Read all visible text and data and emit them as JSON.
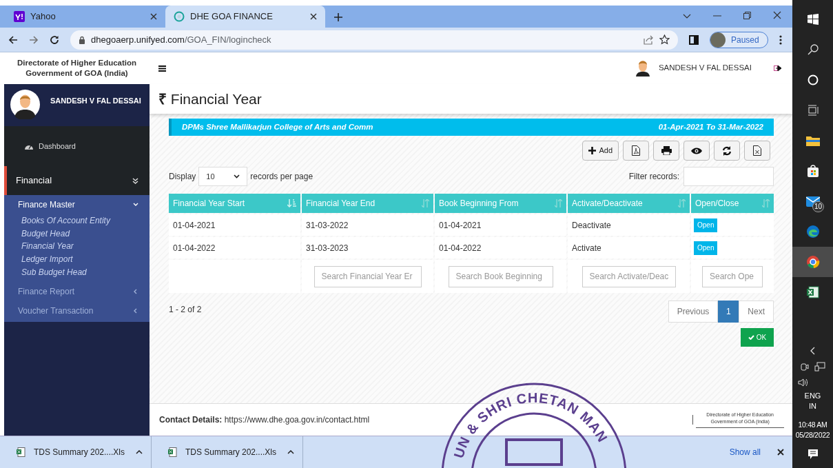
{
  "browser": {
    "tabs": [
      {
        "title": "Yahoo",
        "selected": false
      },
      {
        "title": "DHE GOA FINANCE",
        "selected": true
      }
    ],
    "url_host": "dhegoaerp.unifyed.com",
    "url_path": "/GOA_FIN/logincheck",
    "profile_status": "Paused"
  },
  "header": {
    "org_lines": [
      "Directorate of Higher Education",
      "Government of GOA (India)"
    ],
    "user_name": "SANDESH V FAL DESSAI"
  },
  "sidebar": {
    "user_name": "SANDESH V FAL DESSAI",
    "items": [
      {
        "label": "Dashboard",
        "kind": "link"
      },
      {
        "label": "Financial",
        "kind": "section",
        "expanded": true
      }
    ],
    "groups": [
      {
        "label": "Finance Master",
        "expanded": true,
        "children": [
          {
            "label": "Books Of Account Entity"
          },
          {
            "label": "Budget Head"
          },
          {
            "label": "Financial Year"
          },
          {
            "label": "Ledger Import"
          },
          {
            "label": "Sub Budget Head"
          }
        ]
      },
      {
        "label": "Finance Report",
        "expanded": false
      },
      {
        "label": "Voucher Transaction",
        "expanded": false
      }
    ]
  },
  "page": {
    "currency": "₹",
    "title": "Financial Year",
    "banner": {
      "college": "DPMs Shree Mallikarjun College of Arts and Comm",
      "period": "01-Apr-2021 To 31-Mar-2022"
    },
    "add_label": "Add",
    "length": {
      "label": "Display",
      "value": "10",
      "suffix": "records per page"
    },
    "filter_label": "Filter records:",
    "table": {
      "columns": [
        {
          "label": "Financial Year Start",
          "sorted": true
        },
        {
          "label": "Financial Year End",
          "sorted": false
        },
        {
          "label": "Book Beginning From",
          "sorted": false
        },
        {
          "label": "Activate/Deactivate",
          "sorted": false
        },
        {
          "label": "Open/Close",
          "sorted": false
        }
      ],
      "rows": [
        {
          "cells": [
            "01-04-2021",
            "31-03-2022",
            "01-04-2021",
            "Deactivate"
          ],
          "action": "Open"
        },
        {
          "cells": [
            "01-04-2022",
            "31-03-2023",
            "01-04-2022",
            "Activate"
          ],
          "action": "Open"
        }
      ],
      "search_placeholders": [
        "Search Financial Year Er",
        "Search Book Beginning",
        "Search Activate/Deac",
        "Search Ope"
      ]
    },
    "info": "1 - 2 of 2",
    "pagination": {
      "previous": "Previous",
      "pages": [
        {
          "label": "1",
          "selected": true
        }
      ],
      "next": "Next"
    },
    "ok_label": "OK"
  },
  "footer": {
    "label": "Contact Details:",
    "url": "https://www.dhe.goa.gov.in/contact.html",
    "org_lines": [
      "Directorate of Higher Education",
      "Government of GOA (India)"
    ]
  },
  "stamp": {
    "text": "UN & SHRI CHETAN MAN"
  },
  "downloads": {
    "files": [
      {
        "name": "TDS Summary 202....Xls"
      },
      {
        "name": "TDS Summary 202....Xls"
      }
    ],
    "show_all": "Show all"
  },
  "taskbar": {
    "mail_badge": "10",
    "language": [
      "ENG",
      "IN"
    ],
    "time": "10:48 AM",
    "date": "05/28/2022"
  }
}
